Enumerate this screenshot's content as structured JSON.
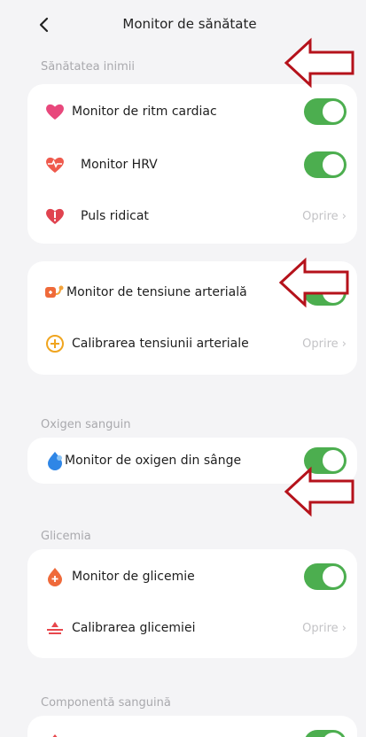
{
  "header": {
    "title": "Monitor de sănătate",
    "back_icon": "chevron-left-icon"
  },
  "sections": {
    "heart": {
      "label": "Sănătatea inimii"
    },
    "oxygen": {
      "label": "Oxigen sanguin"
    },
    "glucose": {
      "label": "Glicemia"
    },
    "blood": {
      "label": "Componentă sanguină"
    }
  },
  "rows": {
    "heart_rate": {
      "label": "Monitor de ritm cardiac",
      "icon": "heart-icon",
      "on": true
    },
    "hrv": {
      "label": "Monitor HRV",
      "icon": "heart-pulse-icon",
      "on": true
    },
    "high_pulse": {
      "label": "Puls ridicat",
      "icon": "heart-alert-icon",
      "status": "Oprire ›"
    },
    "bp_monitor": {
      "label": "Monitor de tensiune arterială",
      "icon": "blood-pressure-icon",
      "on": true
    },
    "bp_calibration": {
      "label": "Calibrarea tensiunii arteriale",
      "icon": "calibration-icon",
      "status": "Oprire ›"
    },
    "spo2": {
      "label": "Monitor de oxigen din sânge",
      "icon": "blood-drop-icon",
      "on": true
    },
    "glucose_monitor": {
      "label": "Monitor de glicemie",
      "icon": "glucose-drop-icon",
      "on": true
    },
    "glucose_calibration": {
      "label": "Calibrarea glicemiei",
      "icon": "scale-icon",
      "status": "Oprire ›"
    }
  },
  "colors": {
    "toggle_on": "#4cae4f",
    "annotation_arrow": "#b5121b"
  }
}
